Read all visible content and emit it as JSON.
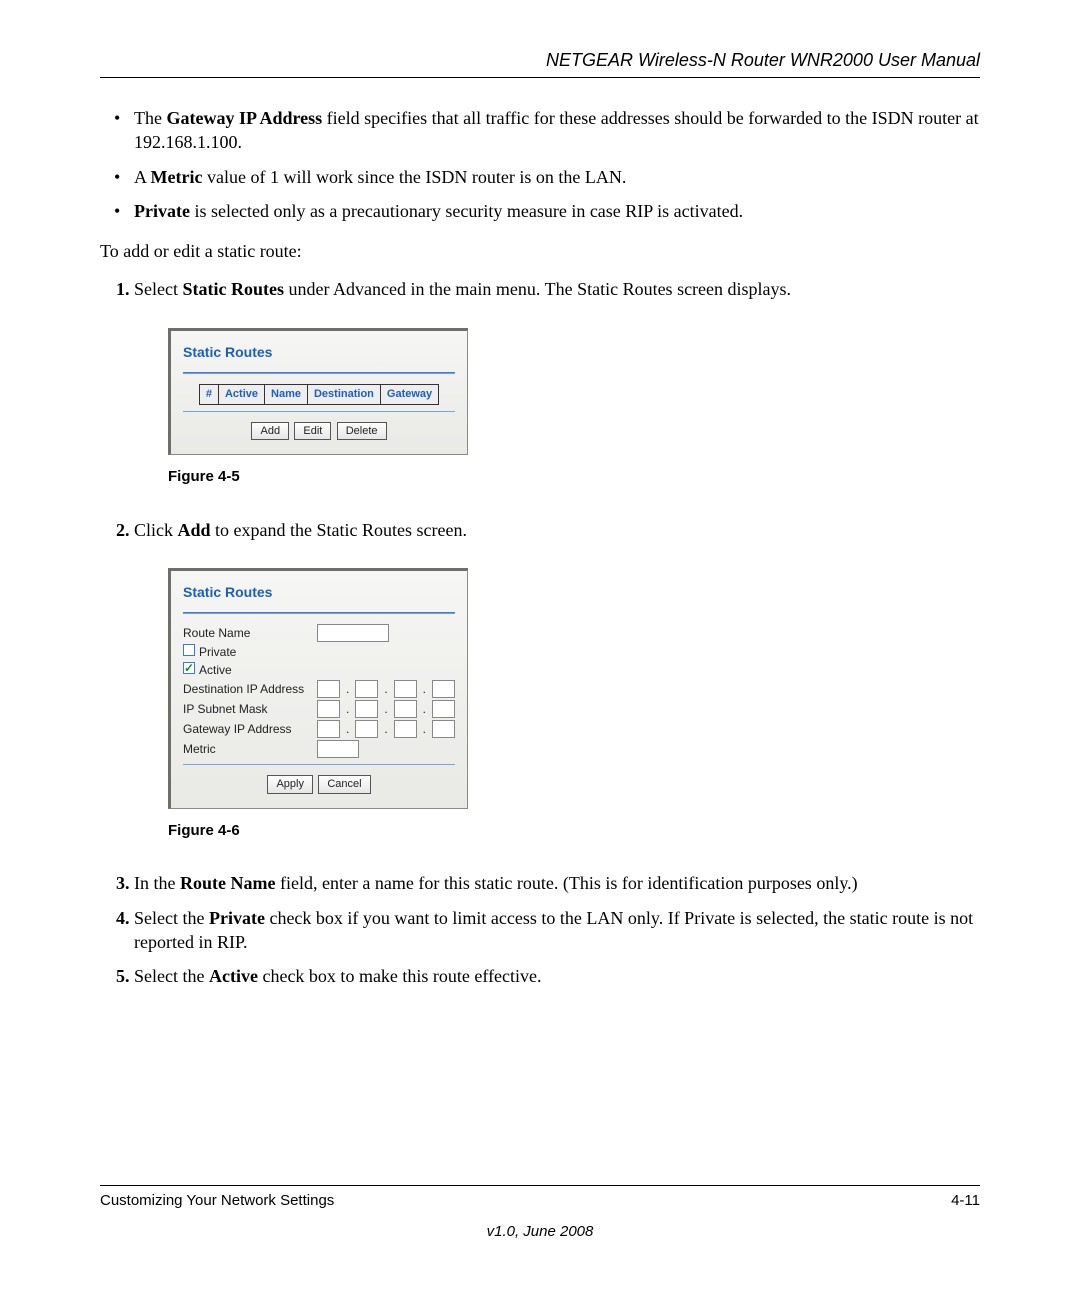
{
  "header": {
    "title": "NETGEAR Wireless-N Router WNR2000 User Manual"
  },
  "bullets": {
    "b1a": "The ",
    "b1b": "Gateway IP Address",
    "b1c": " field specifies that all traffic for these addresses should be forwarded to the ISDN router at 192.168.1.100.",
    "b2a": "A ",
    "b2b": "Metric",
    "b2c": " value of 1 will work since the ISDN router is on the LAN.",
    "b3a": "Private",
    "b3b": " is selected only as a precautionary security measure in case RIP is activated."
  },
  "intro": "To add or edit a static route:",
  "steps": {
    "s1a": "Select ",
    "s1b": "Static Routes",
    "s1c": " under Advanced in the main menu. The Static Routes screen displays.",
    "s2a": "Click ",
    "s2b": "Add",
    "s2c": " to expand the Static Routes screen.",
    "s3a": "In the ",
    "s3b": "Route Name",
    "s3c": " field, enter a name for this static route. (This is for identification purposes only.)",
    "s4a": "Select the ",
    "s4b": "Private",
    "s4c": " check box if you want to limit access to the LAN only. If Private is selected, the static route is not reported in RIP.",
    "s5a": "Select the ",
    "s5b": "Active",
    "s5c": " check box to make this route effective."
  },
  "fig1": {
    "caption": "Figure 4-5",
    "panel_title": "Static Routes",
    "cols": {
      "c1": "#",
      "c2": "Active",
      "c3": "Name",
      "c4": "Destination",
      "c5": "Gateway"
    },
    "buttons": {
      "add": "Add",
      "edit": "Edit",
      "delete": "Delete"
    }
  },
  "fig2": {
    "caption": "Figure 4-6",
    "panel_title": "Static Routes",
    "labels": {
      "route_name": "Route Name",
      "private": "Private",
      "active": "Active",
      "dest": "Destination IP Address",
      "mask": "IP Subnet Mask",
      "gateway": "Gateway IP Address",
      "metric": "Metric"
    },
    "active_checked": true,
    "private_checked": false,
    "buttons": {
      "apply": "Apply",
      "cancel": "Cancel"
    }
  },
  "footer": {
    "left": "Customizing Your Network Settings",
    "right": "4-11",
    "center": "v1.0, June 2008"
  }
}
